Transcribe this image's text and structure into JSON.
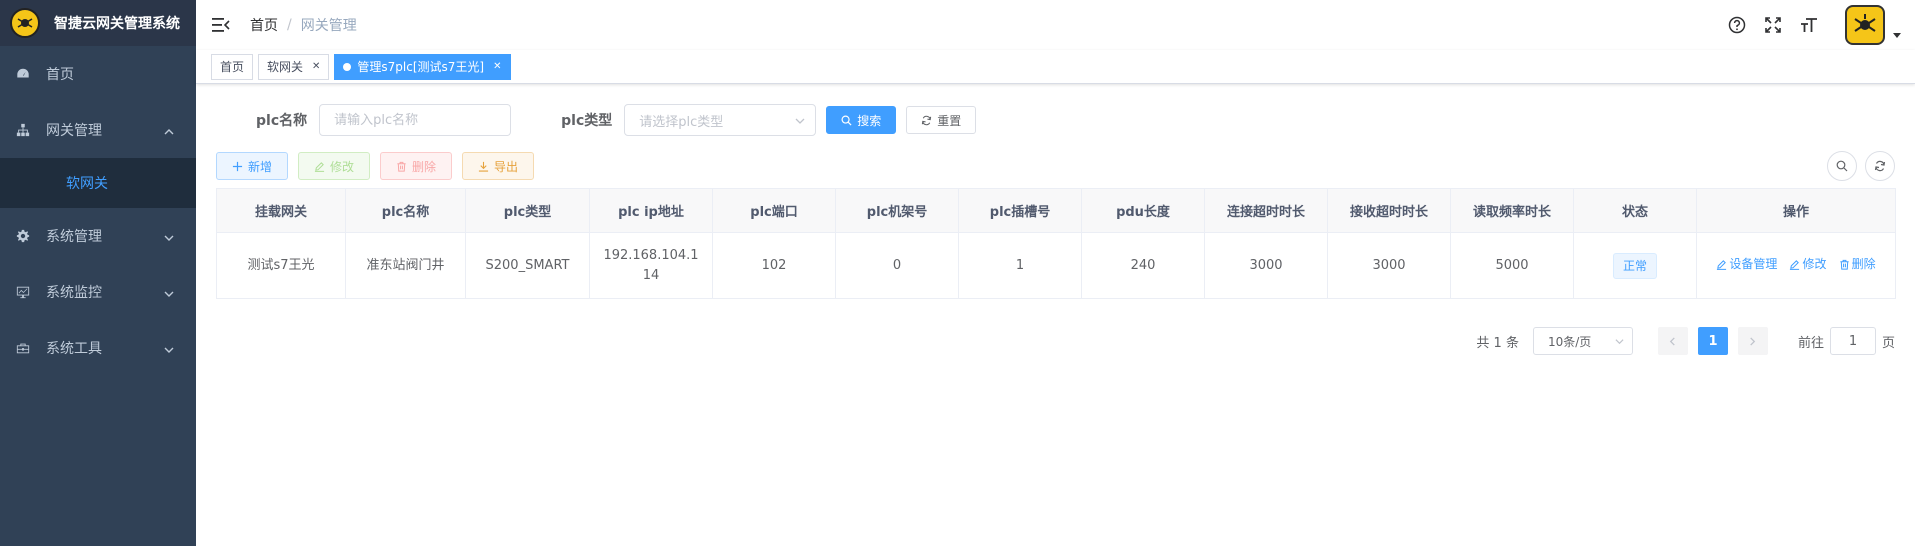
{
  "app": {
    "title": "智捷云网关管理系统"
  },
  "sidebar": {
    "items": [
      {
        "label": "首页",
        "icon": "dashboard-icon"
      },
      {
        "label": "网关管理",
        "icon": "tree-icon",
        "expanded": true,
        "children": [
          {
            "label": "软网关",
            "active": true
          }
        ]
      },
      {
        "label": "系统管理",
        "icon": "gear-icon"
      },
      {
        "label": "系统监控",
        "icon": "monitor-icon"
      },
      {
        "label": "系统工具",
        "icon": "toolbox-icon"
      }
    ]
  },
  "navbar": {
    "breadcrumb": {
      "home": "首页",
      "separator": "/",
      "current": "网关管理"
    }
  },
  "tags": [
    {
      "label": "首页",
      "active": false,
      "closable": false
    },
    {
      "label": "软网关",
      "active": false,
      "closable": true
    },
    {
      "label": "管理s7plc[测试s7王光]",
      "active": true,
      "closable": true
    }
  ],
  "search": {
    "plc_name_label": "plc名称",
    "plc_name_placeholder": "请输入plc名称",
    "plc_type_label": "plc类型",
    "plc_type_placeholder": "请选择plc类型",
    "search_button": "搜索",
    "reset_button": "重置"
  },
  "toolbar": {
    "add": "新增",
    "edit": "修改",
    "delete": "删除",
    "export": "导出"
  },
  "table": {
    "columns": [
      "挂载网关",
      "plc名称",
      "plc类型",
      "plc ip地址",
      "plc端口",
      "plc机架号",
      "plc插槽号",
      "pdu长度",
      "连接超时时长",
      "接收超时时长",
      "读取频率时长",
      "状态",
      "操作"
    ],
    "rows": [
      {
        "gateway": "测试s7王光",
        "plc_name": "准东站阀门井",
        "plc_type": "S200_SMART",
        "ip": "192.168.104.114",
        "port": "102",
        "rack": "0",
        "slot": "1",
        "pdu": "240",
        "conn_timeout": "3000",
        "recv_timeout": "3000",
        "read_freq": "5000",
        "status": "正常",
        "ops": {
          "manage": "设备管理",
          "edit": "修改",
          "delete": "删除"
        }
      }
    ]
  },
  "pagination": {
    "total": "共 1 条",
    "page_size": "10条/页",
    "current_page": "1",
    "goto_label": "前往",
    "goto_value": "1",
    "goto_unit": "页"
  },
  "colors": {
    "primary": "#409eff",
    "sidebar_bg": "#304156",
    "submenu_bg": "#1f2d3d"
  }
}
